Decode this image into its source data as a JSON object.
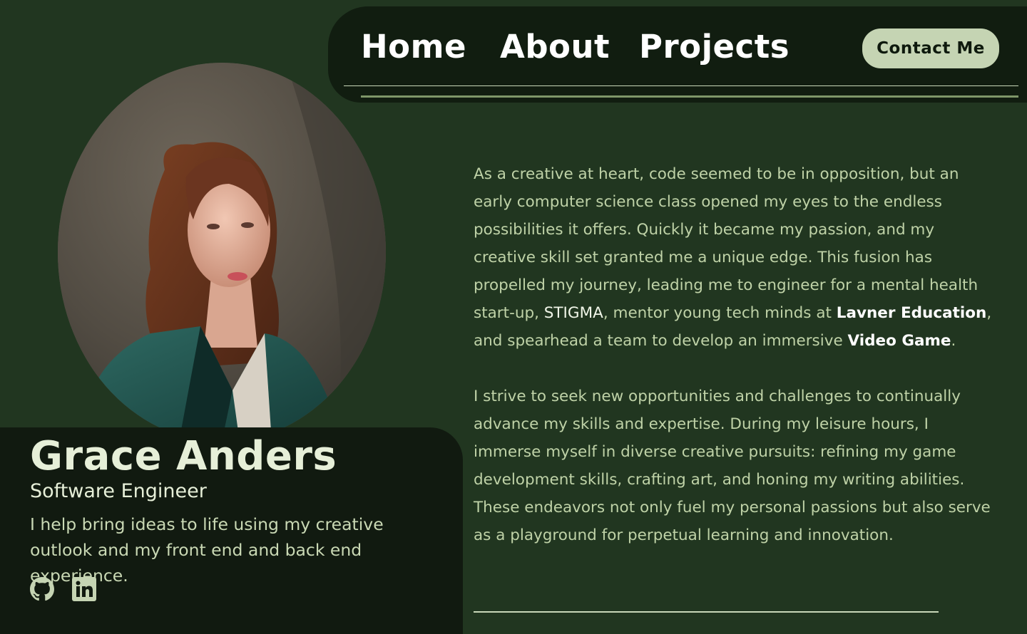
{
  "nav": {
    "links": [
      "Home",
      "About",
      "Projects"
    ],
    "contact_label": "Contact Me"
  },
  "profile": {
    "name": "Grace Anders",
    "role": "Software Engineer",
    "tagline": "I help bring ideas to life using my creative outlook and my front end and back end experience.",
    "social_icons": [
      "github-icon",
      "linkedin-icon"
    ]
  },
  "about": {
    "p1_a": "As a creative at heart, code seemed to be in opposition, but an early computer science class opened my eyes to the endless possibilities it offers. Quickly it became my passion, and my creative skill set granted me a unique edge. This fusion has propelled my journey, leading me to engineer for a mental health start-up, ",
    "p1_stigma": "STIGMA",
    "p1_b": ", mentor young tech minds at ",
    "p1_lavner": "Lavner Education",
    "p1_c": ", and spearhead a team to develop an immersive ",
    "p1_video": "Video Game",
    "p1_d": ".",
    "p2": "I strive to seek new opportunities and challenges to continually advance my skills and expertise. During my leisure hours, I immerse myself in diverse creative pursuits: refining my game development skills, crafting art, and honing my writing abilities. These endeavors not only fuel my personal passions but also serve as a playground for perpetual learning and innovation."
  },
  "colors": {
    "background": "#213620",
    "panel": "#111a10",
    "accent_button": "#c5d4b3",
    "text_light": "#e6efd8",
    "text_body": "#bfd2a7"
  }
}
